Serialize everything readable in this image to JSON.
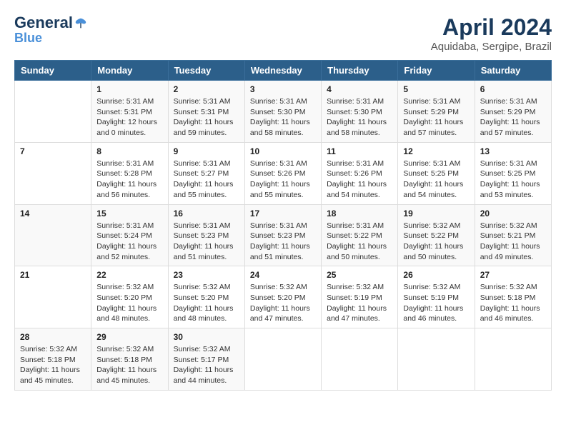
{
  "header": {
    "logo_line1": "General",
    "logo_line2": "Blue",
    "month_title": "April 2024",
    "location": "Aquidaba, Sergipe, Brazil"
  },
  "weekdays": [
    "Sunday",
    "Monday",
    "Tuesday",
    "Wednesday",
    "Thursday",
    "Friday",
    "Saturday"
  ],
  "weeks": [
    [
      {
        "day": "",
        "info": ""
      },
      {
        "day": "1",
        "info": "Sunrise: 5:31 AM\nSunset: 5:31 PM\nDaylight: 12 hours\nand 0 minutes."
      },
      {
        "day": "2",
        "info": "Sunrise: 5:31 AM\nSunset: 5:31 PM\nDaylight: 11 hours\nand 59 minutes."
      },
      {
        "day": "3",
        "info": "Sunrise: 5:31 AM\nSunset: 5:30 PM\nDaylight: 11 hours\nand 58 minutes."
      },
      {
        "day": "4",
        "info": "Sunrise: 5:31 AM\nSunset: 5:30 PM\nDaylight: 11 hours\nand 58 minutes."
      },
      {
        "day": "5",
        "info": "Sunrise: 5:31 AM\nSunset: 5:29 PM\nDaylight: 11 hours\nand 57 minutes."
      },
      {
        "day": "6",
        "info": "Sunrise: 5:31 AM\nSunset: 5:29 PM\nDaylight: 11 hours\nand 57 minutes."
      }
    ],
    [
      {
        "day": "7",
        "info": ""
      },
      {
        "day": "8",
        "info": "Sunrise: 5:31 AM\nSunset: 5:28 PM\nDaylight: 11 hours\nand 56 minutes."
      },
      {
        "day": "9",
        "info": "Sunrise: 5:31 AM\nSunset: 5:27 PM\nDaylight: 11 hours\nand 55 minutes."
      },
      {
        "day": "10",
        "info": "Sunrise: 5:31 AM\nSunset: 5:26 PM\nDaylight: 11 hours\nand 55 minutes."
      },
      {
        "day": "11",
        "info": "Sunrise: 5:31 AM\nSunset: 5:26 PM\nDaylight: 11 hours\nand 54 minutes."
      },
      {
        "day": "12",
        "info": "Sunrise: 5:31 AM\nSunset: 5:25 PM\nDaylight: 11 hours\nand 54 minutes."
      },
      {
        "day": "13",
        "info": "Sunrise: 5:31 AM\nSunset: 5:25 PM\nDaylight: 11 hours\nand 53 minutes."
      }
    ],
    [
      {
        "day": "14",
        "info": ""
      },
      {
        "day": "15",
        "info": "Sunrise: 5:31 AM\nSunset: 5:24 PM\nDaylight: 11 hours\nand 52 minutes."
      },
      {
        "day": "16",
        "info": "Sunrise: 5:31 AM\nSunset: 5:23 PM\nDaylight: 11 hours\nand 51 minutes."
      },
      {
        "day": "17",
        "info": "Sunrise: 5:31 AM\nSunset: 5:23 PM\nDaylight: 11 hours\nand 51 minutes."
      },
      {
        "day": "18",
        "info": "Sunrise: 5:31 AM\nSunset: 5:22 PM\nDaylight: 11 hours\nand 50 minutes."
      },
      {
        "day": "19",
        "info": "Sunrise: 5:32 AM\nSunset: 5:22 PM\nDaylight: 11 hours\nand 50 minutes."
      },
      {
        "day": "20",
        "info": "Sunrise: 5:32 AM\nSunset: 5:21 PM\nDaylight: 11 hours\nand 49 minutes."
      }
    ],
    [
      {
        "day": "21",
        "info": ""
      },
      {
        "day": "22",
        "info": "Sunrise: 5:32 AM\nSunset: 5:20 PM\nDaylight: 11 hours\nand 48 minutes."
      },
      {
        "day": "23",
        "info": "Sunrise: 5:32 AM\nSunset: 5:20 PM\nDaylight: 11 hours\nand 48 minutes."
      },
      {
        "day": "24",
        "info": "Sunrise: 5:32 AM\nSunset: 5:20 PM\nDaylight: 11 hours\nand 47 minutes."
      },
      {
        "day": "25",
        "info": "Sunrise: 5:32 AM\nSunset: 5:19 PM\nDaylight: 11 hours\nand 47 minutes."
      },
      {
        "day": "26",
        "info": "Sunrise: 5:32 AM\nSunset: 5:19 PM\nDaylight: 11 hours\nand 46 minutes."
      },
      {
        "day": "27",
        "info": "Sunrise: 5:32 AM\nSunset: 5:18 PM\nDaylight: 11 hours\nand 46 minutes."
      }
    ],
    [
      {
        "day": "28",
        "info": "Sunrise: 5:32 AM\nSunset: 5:18 PM\nDaylight: 11 hours\nand 45 minutes."
      },
      {
        "day": "29",
        "info": "Sunrise: 5:32 AM\nSunset: 5:18 PM\nDaylight: 11 hours\nand 45 minutes."
      },
      {
        "day": "30",
        "info": "Sunrise: 5:32 AM\nSunset: 5:17 PM\nDaylight: 11 hours\nand 44 minutes."
      },
      {
        "day": "",
        "info": ""
      },
      {
        "day": "",
        "info": ""
      },
      {
        "day": "",
        "info": ""
      },
      {
        "day": "",
        "info": ""
      }
    ]
  ]
}
